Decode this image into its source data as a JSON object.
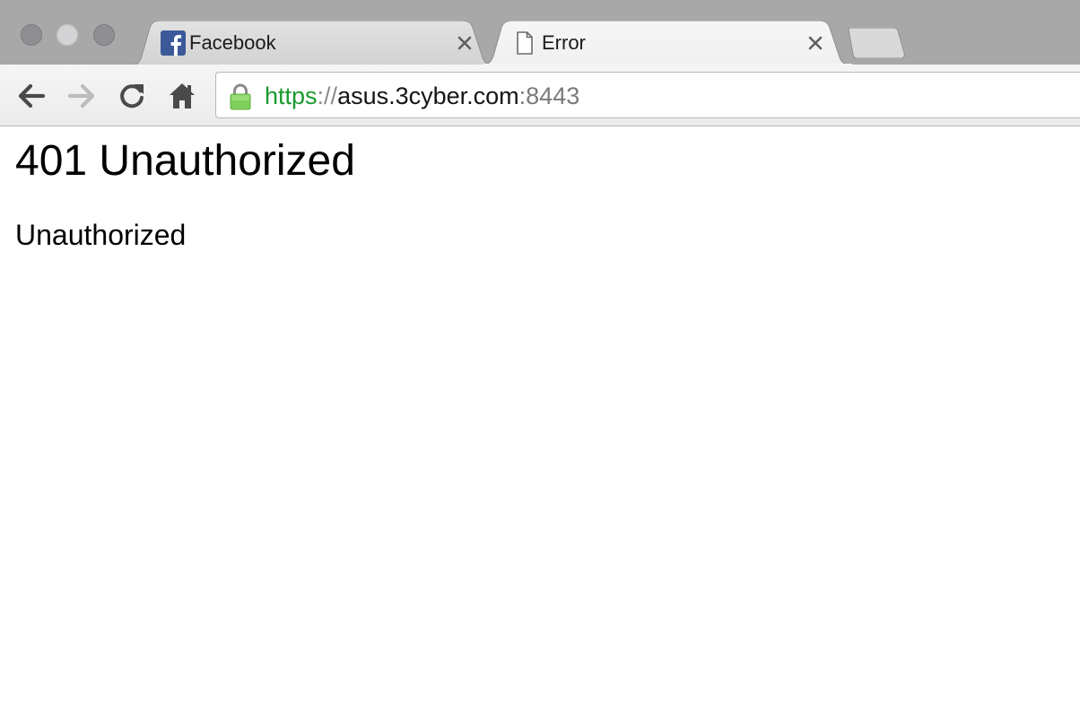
{
  "window": {
    "traffic_lights": [
      "close",
      "minimize",
      "maximize"
    ]
  },
  "tabs": [
    {
      "title": "Facebook",
      "icon": "facebook-icon",
      "active": false,
      "close_icon": "close-icon"
    },
    {
      "title": "Error",
      "icon": "document-icon",
      "active": true,
      "close_icon": "close-icon"
    }
  ],
  "toolbar": {
    "buttons": [
      "back-arrow-icon",
      "forward-arrow-icon",
      "reload-icon",
      "home-icon"
    ],
    "omnibox": {
      "secure_icon": "lock-icon",
      "scheme": "https",
      "separator": "://",
      "host": "asus.3cyber.com",
      "port": ":8443"
    }
  },
  "page": {
    "heading": "401 Unauthorized",
    "message": "Unauthorized"
  },
  "colors": {
    "tabstrip": "#a8a8a8",
    "secure_scheme": "#1a9a2e",
    "lock_green": "#7ed05b"
  }
}
